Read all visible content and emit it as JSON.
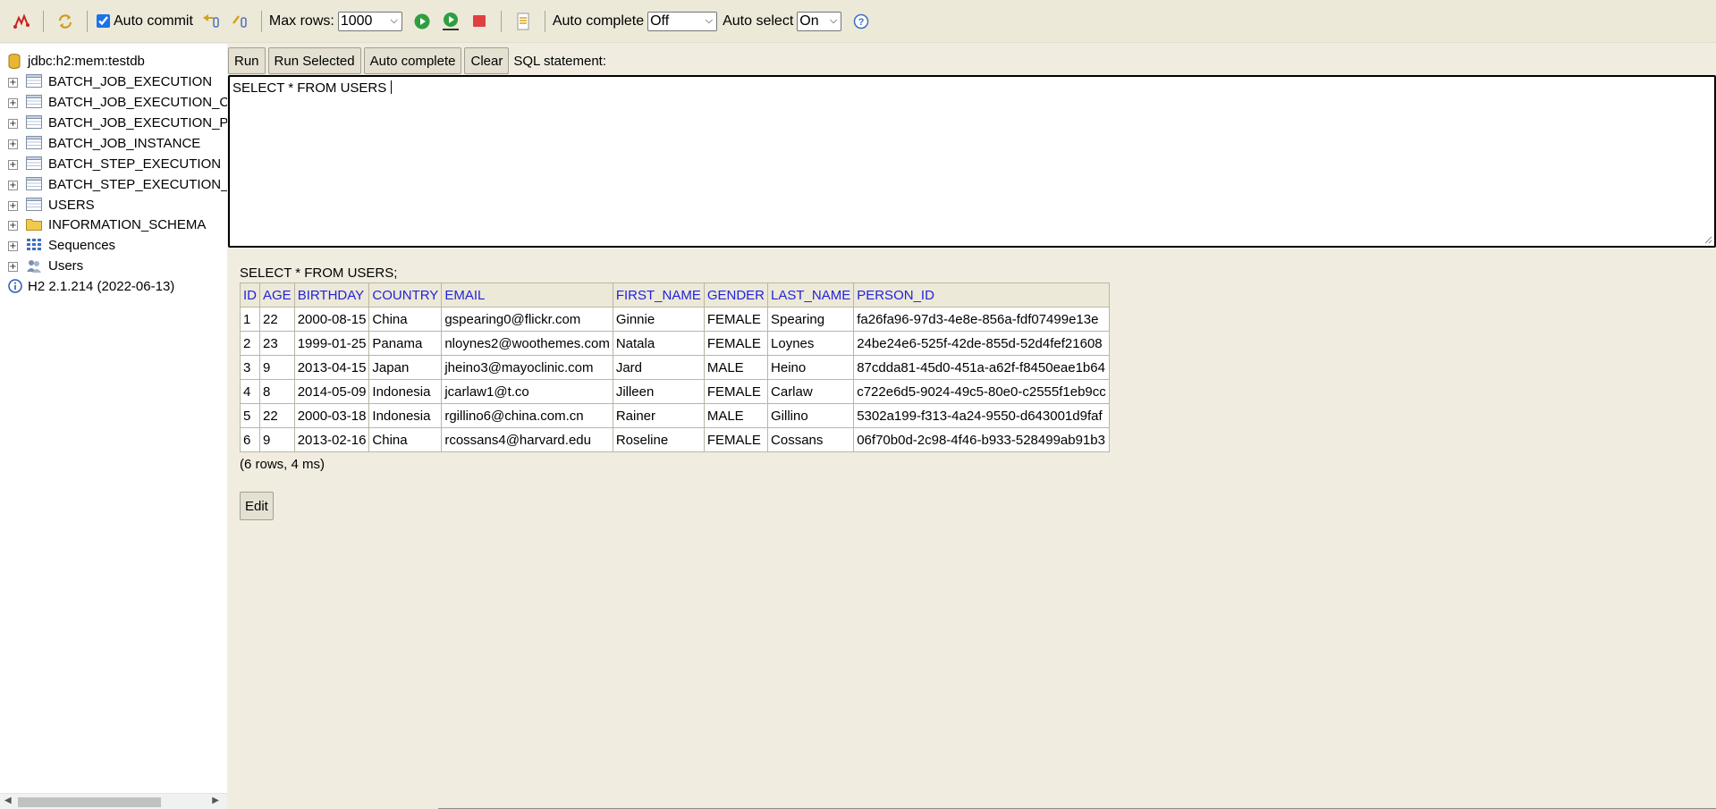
{
  "toolbar": {
    "auto_commit_label": "Auto commit",
    "auto_commit_checked": true,
    "max_rows_label": "Max rows:",
    "max_rows_value": "1000",
    "auto_complete_label": "Auto complete",
    "auto_complete_value": "Off",
    "auto_select_label": "Auto select",
    "auto_select_value": "On",
    "icons": [
      "disconnect-icon",
      "refresh-icon",
      "rollback-icon",
      "commit-icon",
      "run-icon",
      "run-selected-icon",
      "stop-icon",
      "history-icon",
      "help-icon"
    ]
  },
  "tree": {
    "connection": "jdbc:h2:mem:testdb",
    "tables": [
      "BATCH_JOB_EXECUTION",
      "BATCH_JOB_EXECUTION_CONTEXT",
      "BATCH_JOB_EXECUTION_PARAMS",
      "BATCH_JOB_INSTANCE",
      "BATCH_STEP_EXECUTION",
      "BATCH_STEP_EXECUTION_CONTEXT",
      "USERS"
    ],
    "schema": "INFORMATION_SCHEMA",
    "sequences": "Sequences",
    "users": "Users",
    "version": "H2 2.1.214 (2022-06-13)"
  },
  "query": {
    "run_label": "Run",
    "run_selected_label": "Run Selected",
    "auto_complete_label": "Auto complete",
    "clear_label": "Clear",
    "statement_label": "SQL statement:",
    "sql_text": "SELECT * FROM USERS "
  },
  "results": {
    "executed_query": "SELECT * FROM USERS;",
    "columns": [
      "ID",
      "AGE",
      "BIRTHDAY",
      "COUNTRY",
      "EMAIL",
      "FIRST_NAME",
      "GENDER",
      "LAST_NAME",
      "PERSON_ID"
    ],
    "rows": [
      [
        "1",
        "22",
        "2000-08-15",
        "China",
        "gspearing0@flickr.com",
        "Ginnie",
        "FEMALE",
        "Spearing",
        "fa26fa96-97d3-4e8e-856a-fdf07499e13e"
      ],
      [
        "2",
        "23",
        "1999-01-25",
        "Panama",
        "nloynes2@woothemes.com",
        "Natala",
        "FEMALE",
        "Loynes",
        "24be24e6-525f-42de-855d-52d4fef21608"
      ],
      [
        "3",
        "9",
        "2013-04-15",
        "Japan",
        "jheino3@mayoclinic.com",
        "Jard",
        "MALE",
        "Heino",
        "87cdda81-45d0-451a-a62f-f8450eae1b64"
      ],
      [
        "4",
        "8",
        "2014-05-09",
        "Indonesia",
        "jcarlaw1@t.co",
        "Jilleen",
        "FEMALE",
        "Carlaw",
        "c722e6d5-9024-49c5-80e0-c2555f1eb9cc"
      ],
      [
        "5",
        "22",
        "2000-03-18",
        "Indonesia",
        "rgillino6@china.com.cn",
        "Rainer",
        "MALE",
        "Gillino",
        "5302a199-f313-4a24-9550-d643001d9faf"
      ],
      [
        "6",
        "9",
        "2013-02-16",
        "China",
        "rcossans4@harvard.edu",
        "Roseline",
        "FEMALE",
        "Cossans",
        "06f70b0d-2c98-4f46-b933-528499ab91b3"
      ]
    ],
    "summary": "(6 rows, 4 ms)",
    "edit_label": "Edit"
  }
}
